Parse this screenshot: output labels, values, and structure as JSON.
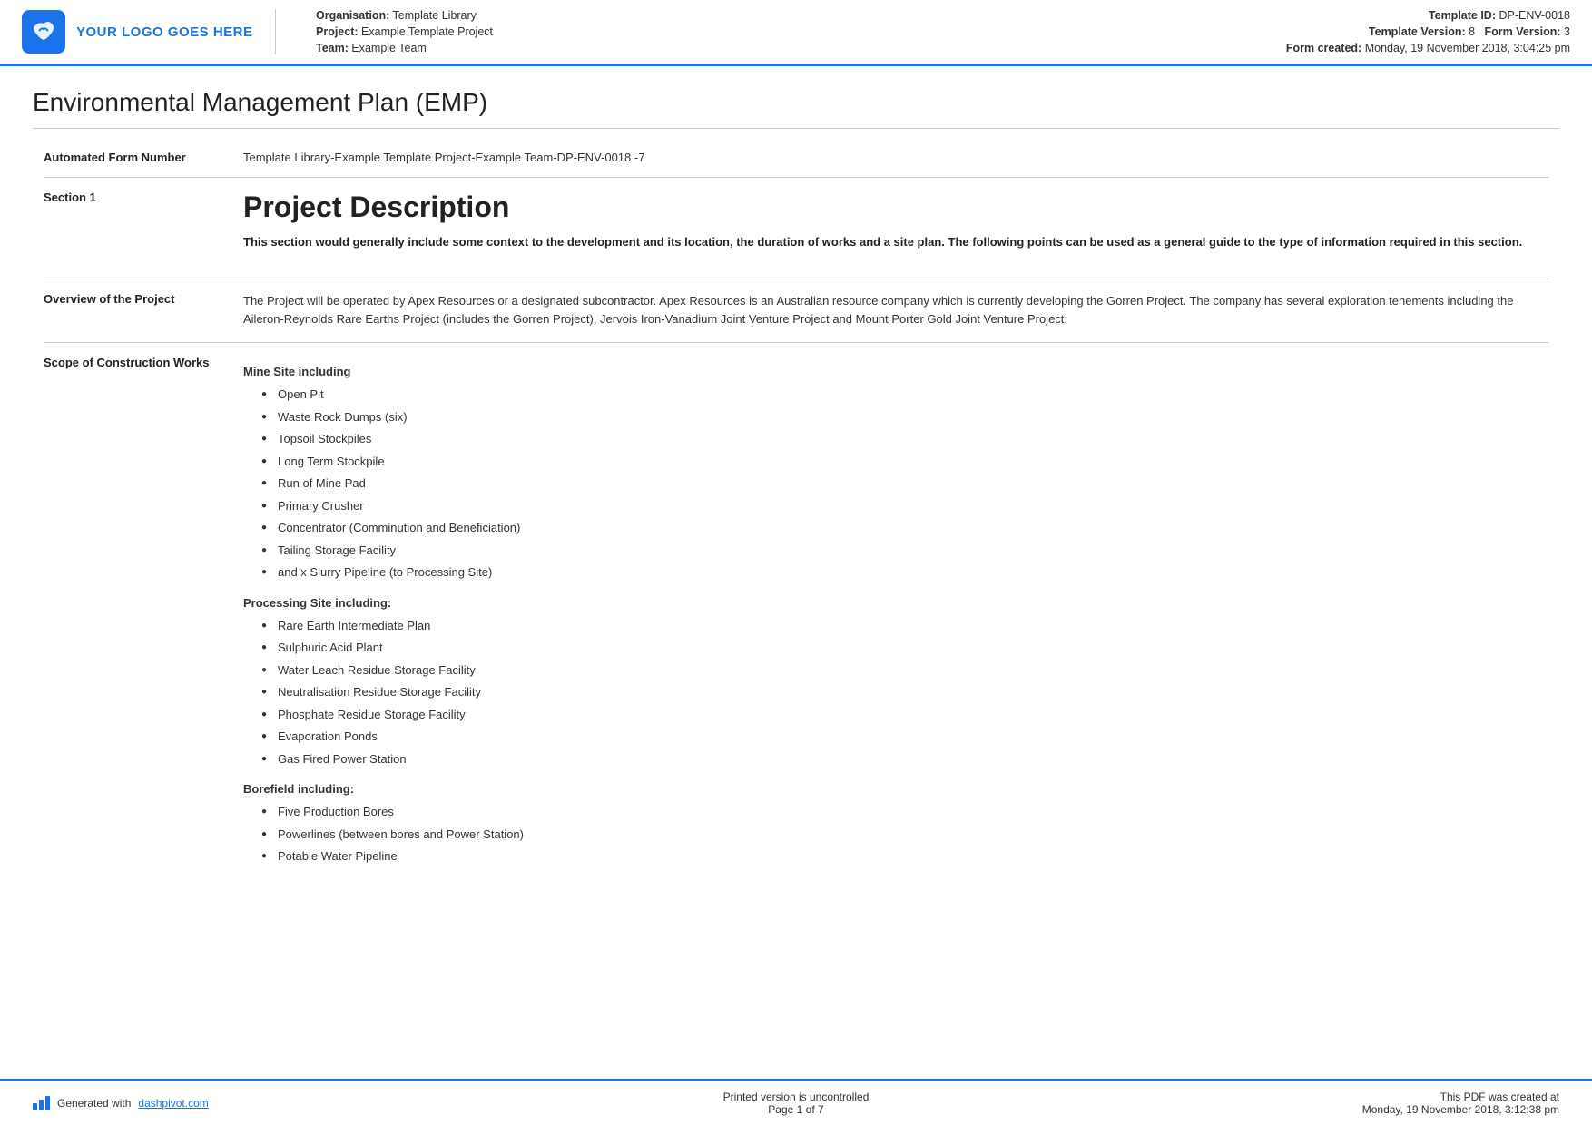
{
  "header": {
    "logo_text": "YOUR LOGO GOES HERE",
    "org_label": "Organisation:",
    "org_value": "Template Library",
    "project_label": "Project:",
    "project_value": "Example Template Project",
    "team_label": "Team:",
    "team_value": "Example Team",
    "template_id_label": "Template ID:",
    "template_id_value": "DP-ENV-0018",
    "template_version_label": "Template Version:",
    "template_version_value": "8",
    "form_version_label": "Form Version:",
    "form_version_value": "3",
    "form_created_label": "Form created:",
    "form_created_value": "Monday, 19 November 2018, 3:04:25 pm"
  },
  "document": {
    "title": "Environmental Management Plan (EMP)",
    "automated_form_label": "Automated Form Number",
    "automated_form_value": "Template Library-Example Template Project-Example Team-DP-ENV-0018   -7",
    "section1_label": "Section 1",
    "section1_title": "Project Description",
    "section1_subtitle": "This section would generally include some context to the development and its location, the duration of works and a site plan. The following points can be used as a general guide to the type of information required in this section.",
    "overview_label": "Overview of the Project",
    "overview_text": "The Project will be operated by Apex Resources or a designated subcontractor. Apex Resources is an Australian resource company which is currently developing the Gorren Project. The company has several exploration tenements including the Aileron-Reynolds Rare Earths Project (includes the Gorren Project), Jervois Iron-Vanadium Joint Venture Project and Mount Porter Gold Joint Venture Project.",
    "scope_label": "Scope of Construction Works",
    "mine_site_title": "Mine Site including",
    "mine_site_items": [
      "Open Pit",
      "Waste Rock Dumps (six)",
      "Topsoil Stockpiles",
      "Long Term Stockpile",
      "Run of Mine Pad",
      "Primary Crusher",
      "Concentrator (Comminution and Beneficiation)",
      "Tailing Storage Facility",
      "and x Slurry Pipeline (to Processing Site)"
    ],
    "processing_site_title": "Processing Site including:",
    "processing_site_items": [
      "Rare Earth Intermediate Plan",
      "Sulphuric Acid Plant",
      "Water Leach Residue Storage Facility",
      "Neutralisation Residue Storage Facility",
      "Phosphate Residue Storage Facility",
      "Evaporation Ponds",
      "Gas Fired Power Station"
    ],
    "borefield_title": "Borefield including:",
    "borefield_items": [
      "Five Production Bores",
      "Powerlines (between bores and Power Station)",
      "Potable Water Pipeline"
    ]
  },
  "footer": {
    "generated_label": "Generated with",
    "generated_link": "dashpivot.com",
    "print_notice": "Printed version is uncontrolled",
    "page_info": "Page 1 of 7",
    "created_label": "This PDF was created at",
    "created_value": "Monday, 19 November 2018, 3:12:38 pm"
  }
}
